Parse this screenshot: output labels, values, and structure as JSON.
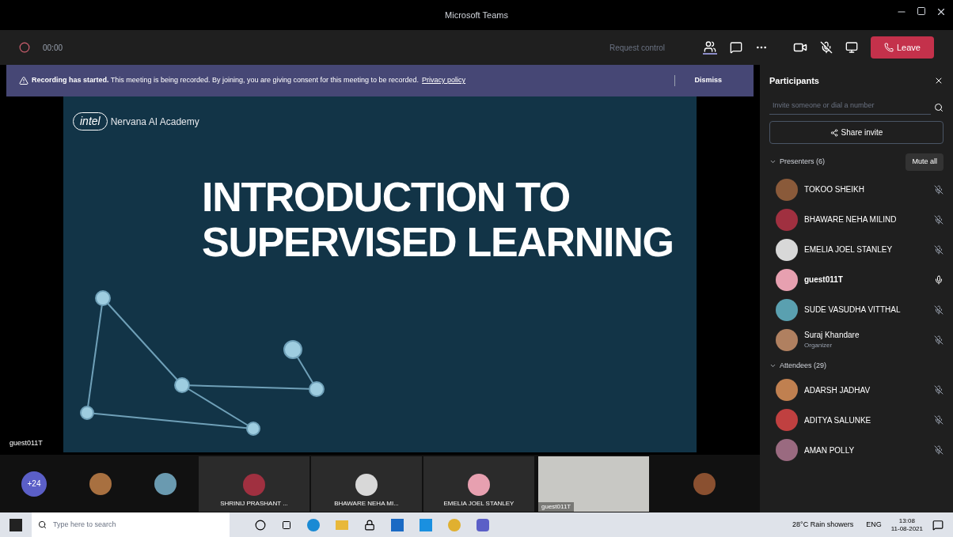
{
  "window": {
    "title": "Microsoft Teams"
  },
  "toolbar": {
    "timer": "00:00",
    "request_control": "Request control",
    "leave": "Leave"
  },
  "banner": {
    "text": "**Recording has started.** This meeting is being recorded. By joining, you are giving consent for this meeting to be recorded.",
    "link": "Privacy policy",
    "dismiss": "Dismiss"
  },
  "slide": {
    "brand": "intel",
    "subtitle": "Nervana AI Academy",
    "title_lines": [
      "INTRODUCTION TO",
      "SUPERVISED LEARNING"
    ]
  },
  "stage_label": "guest011T",
  "strip": {
    "overflow": "+24",
    "tiles": [
      {
        "name": "SHRINIJ PRASHANT ..."
      },
      {
        "name": "BHAWARE NEHA MI..."
      },
      {
        "name": "EMELIA JOEL STANLEY"
      }
    ],
    "video_name": "guest011T"
  },
  "participants": {
    "title": "Participants",
    "search": {
      "placeholder": "Invite someone or dial a number"
    },
    "share": "Share invite",
    "mute_all": "Mute all",
    "sections": [
      {
        "label": "Presenters (6)",
        "expanded": true,
        "people": [
          {
            "name": "TOKOO SHEIKH",
            "mic_on": false
          },
          {
            "name": "BHAWARE NEHA MILIND",
            "mic_on": false
          },
          {
            "name": "EMELIA JOEL STANLEY",
            "mic_on": false
          },
          {
            "name": "guest011T",
            "mic_on": true
          },
          {
            "name": "SUDE VASUDHA VITTHAL",
            "mic_on": false
          },
          {
            "name": "Suraj Khandare",
            "role": "Organizer",
            "mic_on": false
          }
        ]
      },
      {
        "label": "Attendees (29)",
        "expanded": true,
        "people": [
          {
            "name": "ADARSH JADHAV",
            "mic_on": false
          },
          {
            "name": "ADITYA SALUNKE",
            "mic_on": false
          },
          {
            "name": "AMAN POLLY",
            "mic_on": false
          }
        ]
      }
    ]
  },
  "taskbar": {
    "search_placeholder": "Type here to search",
    "weather": "28°C Rain showers",
    "language": "ENG",
    "time": "13:08",
    "date": "11-08-2021"
  }
}
